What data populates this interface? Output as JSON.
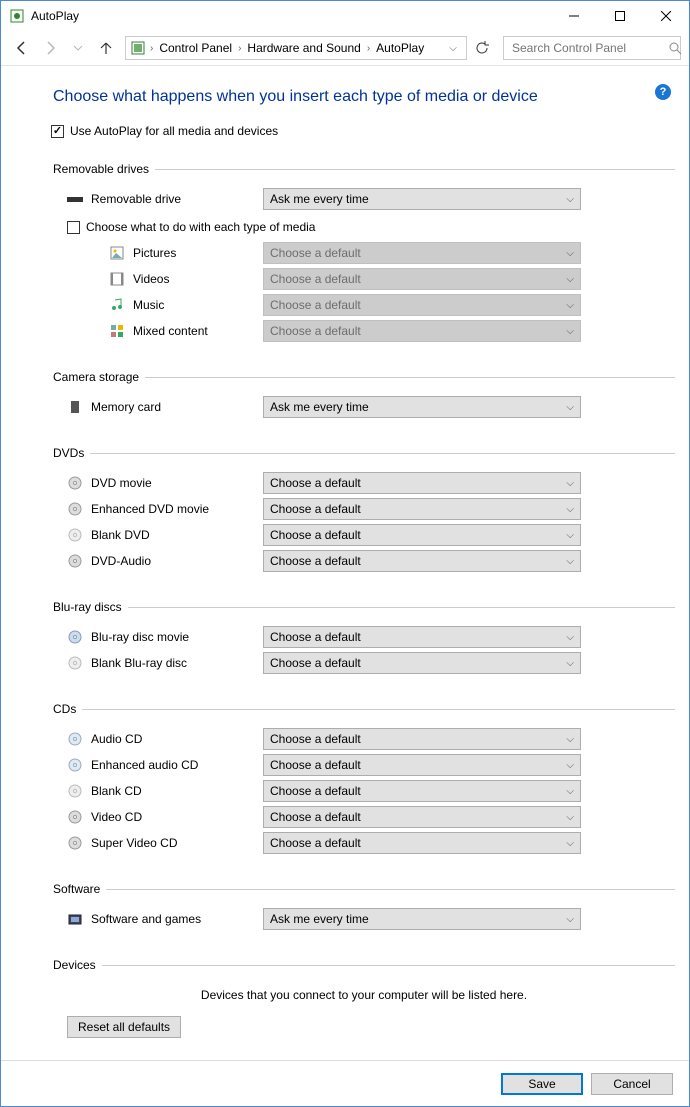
{
  "window": {
    "title": "AutoPlay"
  },
  "breadcrumb": {
    "seg1": "Control Panel",
    "seg2": "Hardware and Sound",
    "seg3": "AutoPlay"
  },
  "search": {
    "placeholder": "Search Control Panel"
  },
  "heading": "Choose what happens when you insert each type of media or device",
  "use_autoplay_label": "Use AutoPlay for all media and devices",
  "choose_eachtype_label": "Choose what to do with each type of media",
  "defaults": {
    "choose": "Choose a default",
    "ask": "Ask me every time"
  },
  "sections": {
    "removable": {
      "title": "Removable drives",
      "row": "Removable drive",
      "subs": {
        "pictures": "Pictures",
        "videos": "Videos",
        "music": "Music",
        "mixed": "Mixed content"
      }
    },
    "camera": {
      "title": "Camera storage",
      "row": "Memory card"
    },
    "dvds": {
      "title": "DVDs",
      "r1": "DVD movie",
      "r2": "Enhanced DVD movie",
      "r3": "Blank DVD",
      "r4": "DVD-Audio"
    },
    "bluray": {
      "title": "Blu-ray discs",
      "r1": "Blu-ray disc movie",
      "r2": "Blank Blu-ray disc"
    },
    "cds": {
      "title": "CDs",
      "r1": "Audio CD",
      "r2": "Enhanced audio CD",
      "r3": "Blank CD",
      "r4": "Video CD",
      "r5": "Super Video CD"
    },
    "software": {
      "title": "Software",
      "row": "Software and games"
    },
    "devices": {
      "title": "Devices",
      "msg": "Devices that you connect to your computer will be listed here."
    }
  },
  "buttons": {
    "reset": "Reset all defaults",
    "save": "Save",
    "cancel": "Cancel"
  }
}
